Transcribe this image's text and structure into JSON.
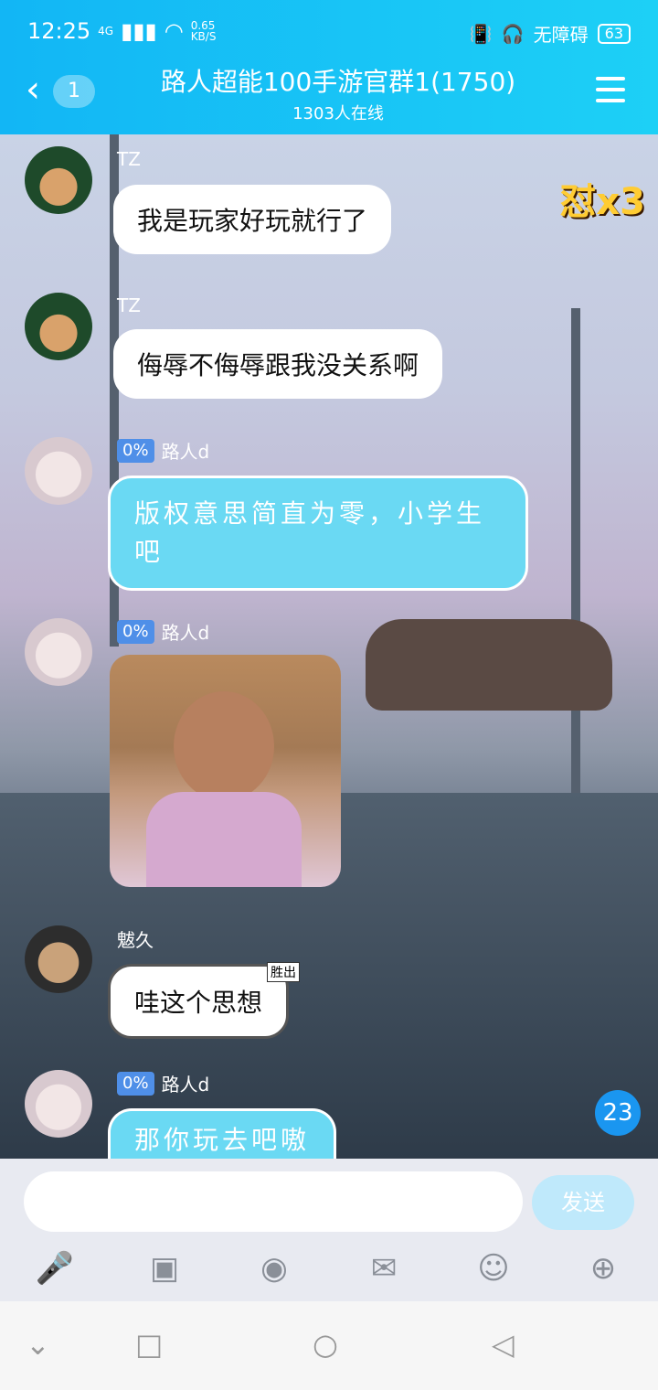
{
  "status_bar": {
    "time": "12:25",
    "network": "4G",
    "speed": "0.65\nKB/S",
    "accessibility": "无障碍",
    "battery": "63"
  },
  "header": {
    "back_badge": "1",
    "title": "路人超能100手游官群1(1750)",
    "online": "1303人在线"
  },
  "sticker_text": "怼x3",
  "messages": [
    {
      "sender": "TZ",
      "text": "我是玩家好玩就行了"
    },
    {
      "sender": "TZ",
      "text": "侮辱不侮辱跟我没关系啊"
    },
    {
      "sender": "路人d",
      "level": "0%",
      "text": "版权意思简直为零，小学生吧"
    },
    {
      "sender": "路人d",
      "level": "0%",
      "image": "photo"
    },
    {
      "sender": "魃久",
      "text": "哇这个思想",
      "tag": "胜出"
    },
    {
      "sender": "路人d",
      "level": "0%",
      "text": "那你玩去吧嗷"
    }
  ],
  "unread_count": "23",
  "composer": {
    "send_label": "发送",
    "tools": [
      "microphone-icon",
      "image-icon",
      "camera-icon",
      "red-packet-icon",
      "emoji-icon",
      "plus-icon"
    ]
  },
  "nav": [
    "down-icon",
    "square-icon",
    "circle-icon",
    "back-triangle-icon"
  ]
}
